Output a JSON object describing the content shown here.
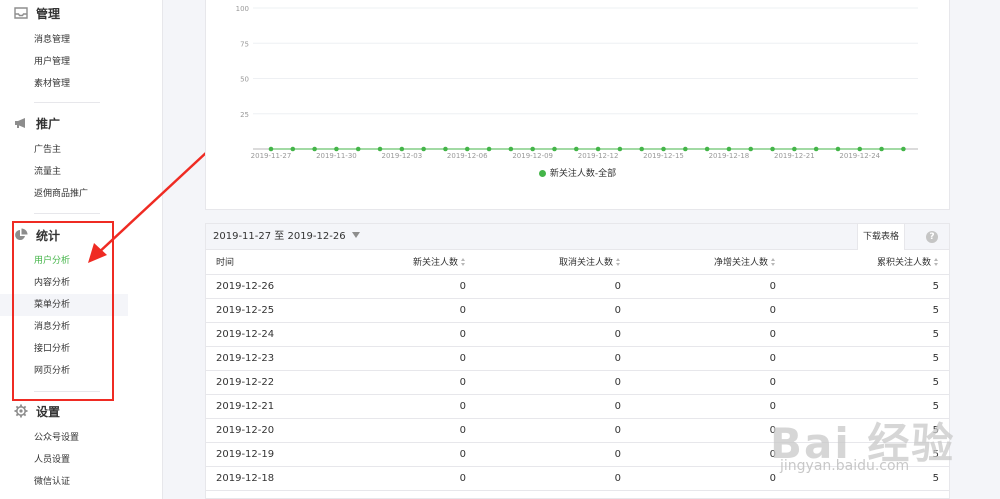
{
  "sidebar": {
    "sections": [
      {
        "title": "管理",
        "icon": "inbox-icon",
        "items": [
          "消息管理",
          "用户管理",
          "素材管理"
        ]
      },
      {
        "title": "推广",
        "icon": "megaphone-icon",
        "items": [
          "广告主",
          "流量主",
          "返佣商品推广"
        ]
      },
      {
        "title": "统计",
        "icon": "pie-chart-icon",
        "items": [
          "用户分析",
          "内容分析",
          "菜单分析",
          "消息分析",
          "接口分析",
          "网页分析"
        ]
      },
      {
        "title": "设置",
        "icon": "gear-icon",
        "items": [
          "公众号设置",
          "人员设置",
          "微信认证"
        ]
      }
    ],
    "active_item": "用户分析"
  },
  "chart_data": {
    "type": "line",
    "title": "",
    "xlabel": "",
    "ylabel": "",
    "ylim": [
      0,
      100
    ],
    "yticks": [
      100,
      75,
      50,
      25
    ],
    "xticks": [
      "2019-11-27",
      "2019-11-30",
      "2019-12-03",
      "2019-12-06",
      "2019-12-09",
      "2019-12-12",
      "2019-12-15",
      "2019-12-18",
      "2019-12-21",
      "2019-12-24"
    ],
    "x": [
      "2019-11-27",
      "2019-11-28",
      "2019-11-29",
      "2019-11-30",
      "2019-12-01",
      "2019-12-02",
      "2019-12-03",
      "2019-12-04",
      "2019-12-05",
      "2019-12-06",
      "2019-12-07",
      "2019-12-08",
      "2019-12-09",
      "2019-12-10",
      "2019-12-11",
      "2019-12-12",
      "2019-12-13",
      "2019-12-14",
      "2019-12-15",
      "2019-12-16",
      "2019-12-17",
      "2019-12-18",
      "2019-12-19",
      "2019-12-20",
      "2019-12-21",
      "2019-12-22",
      "2019-12-23",
      "2019-12-24",
      "2019-12-25",
      "2019-12-26"
    ],
    "series": [
      {
        "name": "新关注人数-全部",
        "color": "#44b549",
        "values": [
          0,
          0,
          0,
          0,
          0,
          0,
          0,
          0,
          0,
          0,
          0,
          0,
          0,
          0,
          0,
          0,
          0,
          0,
          0,
          0,
          0,
          0,
          0,
          0,
          0,
          0,
          0,
          0,
          0,
          0
        ]
      }
    ],
    "legend_position": "bottom"
  },
  "table": {
    "date_range": "2019-11-27 至 2019-12-26",
    "download_label": "下载表格",
    "help_label": "?",
    "columns": [
      "时间",
      "新关注人数",
      "取消关注人数",
      "净增关注人数",
      "累积关注人数"
    ],
    "rows": [
      [
        "2019-12-26",
        "0",
        "0",
        "0",
        "5"
      ],
      [
        "2019-12-25",
        "0",
        "0",
        "0",
        "5"
      ],
      [
        "2019-12-24",
        "0",
        "0",
        "0",
        "5"
      ],
      [
        "2019-12-23",
        "0",
        "0",
        "0",
        "5"
      ],
      [
        "2019-12-22",
        "0",
        "0",
        "0",
        "5"
      ],
      [
        "2019-12-21",
        "0",
        "0",
        "0",
        "5"
      ],
      [
        "2019-12-20",
        "0",
        "0",
        "0",
        "5"
      ],
      [
        "2019-12-19",
        "0",
        "0",
        "0",
        "5"
      ],
      [
        "2019-12-18",
        "0",
        "0",
        "0",
        "5"
      ]
    ]
  },
  "watermark": {
    "main": "Bai 经验",
    "sub": "jingyan.baidu.com"
  },
  "colors": {
    "accent": "#44b549",
    "annotation": "#ef2b23"
  }
}
